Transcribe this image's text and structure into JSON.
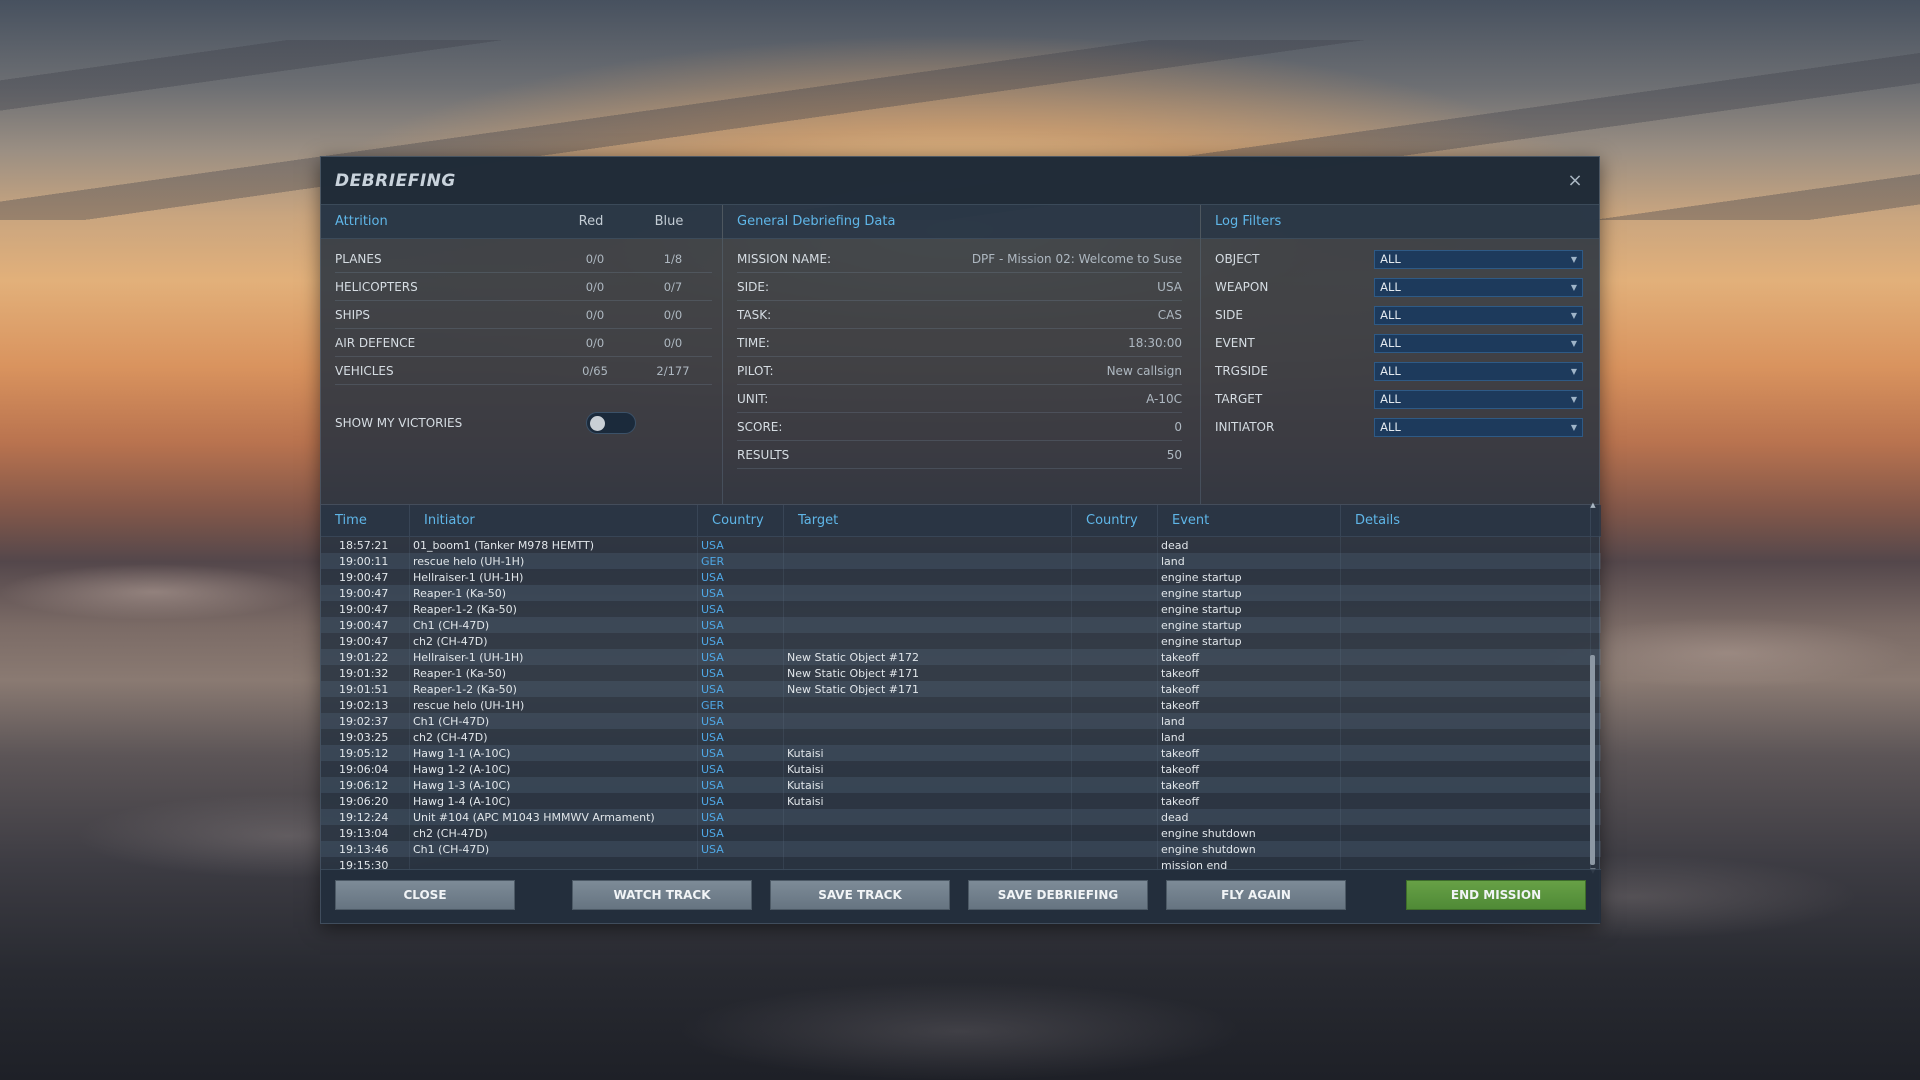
{
  "dialog": {
    "title": "DEBRIEFING",
    "close_icon": "×"
  },
  "attrition": {
    "header": "Attrition",
    "col_red": "Red",
    "col_blue": "Blue",
    "rows": [
      {
        "label": "PLANES",
        "red": "0/0",
        "blue": "1/8"
      },
      {
        "label": "HELICOPTERS",
        "red": "0/0",
        "blue": "0/7"
      },
      {
        "label": "SHIPS",
        "red": "0/0",
        "blue": "0/0"
      },
      {
        "label": "AIR DEFENCE",
        "red": "0/0",
        "blue": "0/0"
      },
      {
        "label": "VEHICLES",
        "red": "0/65",
        "blue": "2/177"
      }
    ],
    "show_my_victories": "SHOW MY VICTORIES",
    "show_my_victories_on": false
  },
  "general": {
    "header": "General Debriefing Data",
    "rows": [
      {
        "label": "MISSION NAME:",
        "value": "DPF - Mission 02: Welcome to Suse"
      },
      {
        "label": "SIDE:",
        "value": "USA"
      },
      {
        "label": "TASK:",
        "value": "CAS"
      },
      {
        "label": "TIME:",
        "value": "18:30:00"
      },
      {
        "label": "PILOT:",
        "value": "New callsign"
      },
      {
        "label": "UNIT:",
        "value": "A-10C"
      },
      {
        "label": "SCORE:",
        "value": "0"
      },
      {
        "label": "RESULTS",
        "value": "50"
      }
    ]
  },
  "filters": {
    "header": "Log Filters",
    "rows": [
      {
        "label": "OBJECT",
        "value": "ALL"
      },
      {
        "label": "WEAPON",
        "value": "ALL"
      },
      {
        "label": "SIDE",
        "value": "ALL"
      },
      {
        "label": "EVENT",
        "value": "ALL"
      },
      {
        "label": "TRGSIDE",
        "value": "ALL"
      },
      {
        "label": "TARGET",
        "value": "ALL"
      },
      {
        "label": "INITIATOR",
        "value": "ALL"
      }
    ]
  },
  "log": {
    "columns": [
      "Time",
      "Initiator",
      "Country",
      "Target",
      "Country",
      "Event",
      "Details"
    ],
    "rows": [
      [
        "18:57:21",
        "01_boom1 (Tanker M978 HEMTT)",
        "USA",
        "",
        "",
        "dead",
        ""
      ],
      [
        "19:00:11",
        "rescue helo (UH-1H)",
        "GER",
        "",
        "",
        "land",
        ""
      ],
      [
        "19:00:47",
        "Hellraiser-1 (UH-1H)",
        "USA",
        "",
        "",
        "engine startup",
        ""
      ],
      [
        "19:00:47",
        "Reaper-1 (Ka-50)",
        "USA",
        "",
        "",
        "engine startup",
        ""
      ],
      [
        "19:00:47",
        "Reaper-1-2 (Ka-50)",
        "USA",
        "",
        "",
        "engine startup",
        ""
      ],
      [
        "19:00:47",
        "Ch1 (CH-47D)",
        "USA",
        "",
        "",
        "engine startup",
        ""
      ],
      [
        "19:00:47",
        "ch2 (CH-47D)",
        "USA",
        "",
        "",
        "engine startup",
        ""
      ],
      [
        "19:01:22",
        "Hellraiser-1 (UH-1H)",
        "USA",
        "New Static Object #172",
        "",
        "takeoff",
        ""
      ],
      [
        "19:01:32",
        "Reaper-1 (Ka-50)",
        "USA",
        "New Static Object #171",
        "",
        "takeoff",
        ""
      ],
      [
        "19:01:51",
        "Reaper-1-2 (Ka-50)",
        "USA",
        "New Static Object #171",
        "",
        "takeoff",
        ""
      ],
      [
        "19:02:13",
        "rescue helo (UH-1H)",
        "GER",
        "",
        "",
        "takeoff",
        ""
      ],
      [
        "19:02:37",
        "Ch1 (CH-47D)",
        "USA",
        "",
        "",
        "land",
        ""
      ],
      [
        "19:03:25",
        "ch2 (CH-47D)",
        "USA",
        "",
        "",
        "land",
        ""
      ],
      [
        "19:05:12",
        "Hawg 1-1 (A-10C)",
        "USA",
        "Kutaisi",
        "",
        "takeoff",
        ""
      ],
      [
        "19:06:04",
        "Hawg 1-2 (A-10C)",
        "USA",
        "Kutaisi",
        "",
        "takeoff",
        ""
      ],
      [
        "19:06:12",
        "Hawg 1-3 (A-10C)",
        "USA",
        "Kutaisi",
        "",
        "takeoff",
        ""
      ],
      [
        "19:06:20",
        "Hawg 1-4 (A-10C)",
        "USA",
        "Kutaisi",
        "",
        "takeoff",
        ""
      ],
      [
        "19:12:24",
        "Unit #104 (APC M1043 HMMWV Armament)",
        "USA",
        "",
        "",
        "dead",
        ""
      ],
      [
        "19:13:04",
        "ch2 (CH-47D)",
        "USA",
        "",
        "",
        "engine shutdown",
        ""
      ],
      [
        "19:13:46",
        "Ch1 (CH-47D)",
        "USA",
        "",
        "",
        "engine shutdown",
        ""
      ],
      [
        "19:15:30",
        "",
        "",
        "",
        "",
        "mission end",
        ""
      ]
    ]
  },
  "footer": {
    "close": "CLOSE",
    "watch_track": "WATCH TRACK",
    "save_track": "SAVE TRACK",
    "save_debriefing": "SAVE DEBRIEFING",
    "fly_again": "FLY AGAIN",
    "end_mission": "END MISSION"
  },
  "colors": {
    "accent": "#5fb6e8",
    "country": "#4fa8e6",
    "end_mission": "#5b9a3f",
    "button": "#73818d"
  }
}
